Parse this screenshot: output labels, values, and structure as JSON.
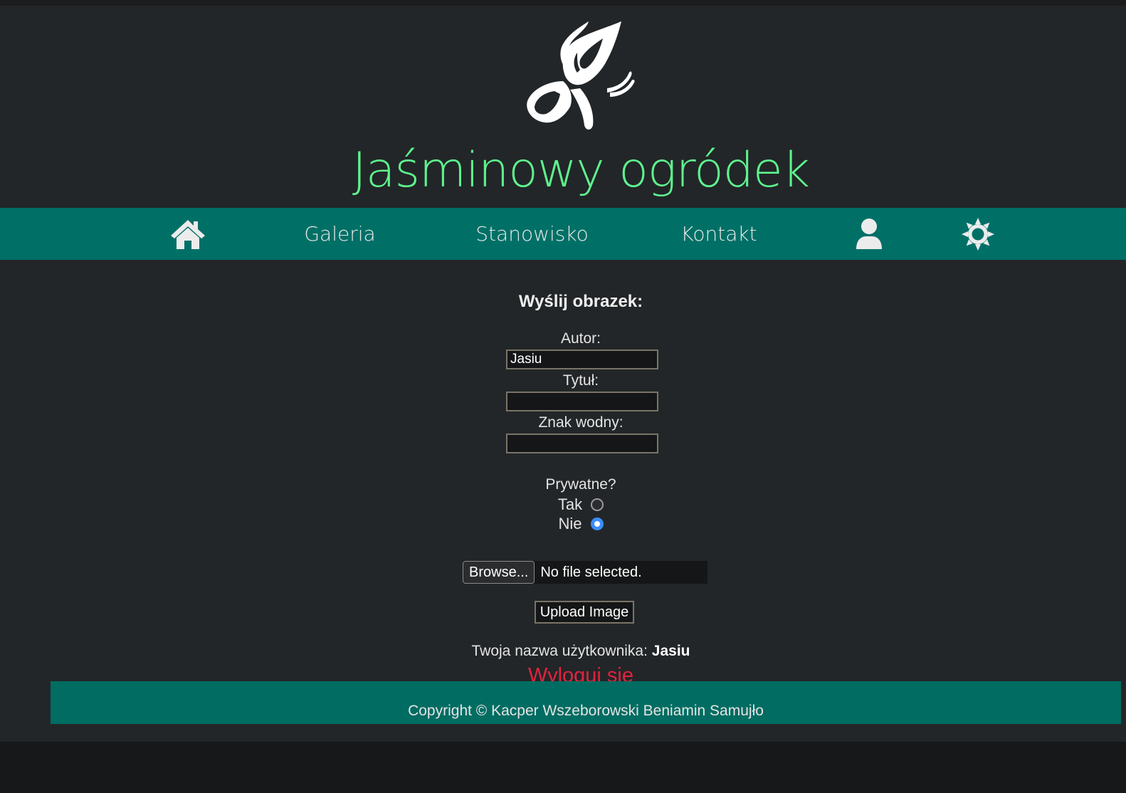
{
  "header": {
    "logo_icon": "butterfly-icon",
    "site_title": "Jaśminowy ogródek"
  },
  "nav": {
    "home_icon": "home-icon",
    "gallery": "Galeria",
    "position": "Stanowisko",
    "contact": "Kontakt",
    "user_icon": "user-icon",
    "theme_icon": "sun-icon"
  },
  "form": {
    "title": "Wyślij obrazek:",
    "author_label": "Autor:",
    "author_value": "Jasiu",
    "title_label": "Tytuł:",
    "title_value": "",
    "watermark_label": "Znak wodny:",
    "watermark_value": "",
    "private_label": "Prywatne?",
    "private_yes": "Tak",
    "private_no": "Nie",
    "private_selected": "Nie",
    "browse_label": "Browse...",
    "file_status": "No file selected.",
    "upload_label": "Upload Image"
  },
  "session": {
    "username_label": "Twoja nazwa użytkownika:",
    "username": "Jasiu",
    "logout": "Wyloguj się"
  },
  "footer": {
    "copyright": "Copyright © Kacper Wszeborowski Beniamin Samujło"
  },
  "colors": {
    "accent_green": "#5ef38e",
    "nav_teal": "#007067",
    "logout_red": "#e3223f",
    "background": "#222628"
  }
}
